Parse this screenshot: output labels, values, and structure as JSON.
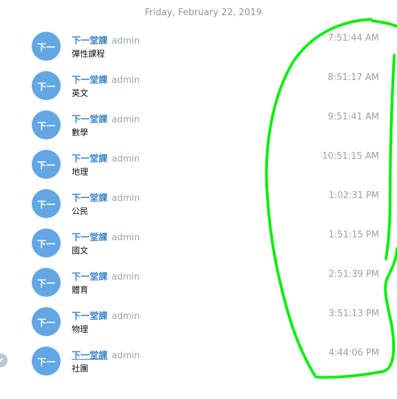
{
  "date_separator": "Friday, February 22, 2019",
  "accent_colors": {
    "avatar": "#62a7e3",
    "sender": "#3d84c6",
    "annotation": "#00f000"
  },
  "messages": [
    {
      "avatar": "下一",
      "sender": "下一堂課",
      "via": "admin",
      "text": "彈性課程",
      "time": "7:51:44 AM"
    },
    {
      "avatar": "下一",
      "sender": "下一堂課",
      "via": "admin",
      "text": "英文",
      "time": "8:51:17 AM"
    },
    {
      "avatar": "下一",
      "sender": "下一堂課",
      "via": "admin",
      "text": "數學",
      "time": "9:51:41 AM"
    },
    {
      "avatar": "下一",
      "sender": "下一堂課",
      "via": "admin",
      "text": "地理",
      "time": "10:51:15 AM"
    },
    {
      "avatar": "下一",
      "sender": "下一堂課",
      "via": "admin",
      "text": "公民",
      "time": "1:02:31 PM"
    },
    {
      "avatar": "下一",
      "sender": "下一堂課",
      "via": "admin",
      "text": "國文",
      "time": "1:51:15 PM"
    },
    {
      "avatar": "下一",
      "sender": "下一堂課",
      "via": "admin",
      "text": "體育",
      "time": "2:51:39 PM"
    },
    {
      "avatar": "下一",
      "sender": "下一堂課",
      "via": "admin",
      "text": "物理",
      "time": "3:51:13 PM"
    },
    {
      "avatar": "下一",
      "sender": "下一堂課",
      "via": "admin",
      "text": "社團",
      "time": "4:44:06 PM"
    }
  ]
}
